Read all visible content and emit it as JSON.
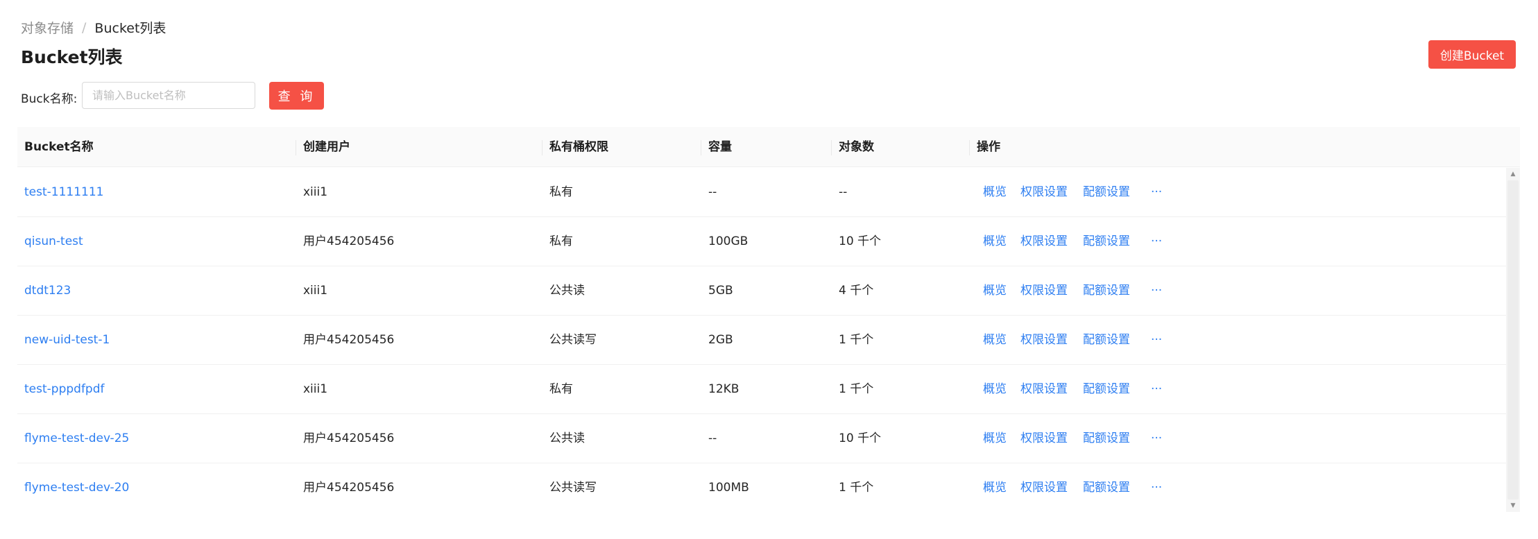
{
  "breadcrumb": {
    "root": "对象存储",
    "separator": "/",
    "current": "Bucket列表"
  },
  "page": {
    "title": "Bucket列表",
    "create_button": "创建Bucket"
  },
  "filter": {
    "label": "Buck名称:",
    "placeholder": "请输入Bucket名称",
    "value": "",
    "query_button": "查 询"
  },
  "table": {
    "columns": [
      "Bucket名称",
      "创建用户",
      "私有桶权限",
      "容量",
      "对象数",
      "操作"
    ],
    "rows": [
      {
        "name": "test-1111111",
        "user": "xiii1",
        "permission": "私有",
        "capacity": "--",
        "objects": "--"
      },
      {
        "name": "qisun-test",
        "user": "用户454205456",
        "permission": "私有",
        "capacity": "100GB",
        "objects": "10 千个"
      },
      {
        "name": "dtdt123",
        "user": "xiii1",
        "permission": "公共读",
        "capacity": "5GB",
        "objects": "4 千个"
      },
      {
        "name": "new-uid-test-1",
        "user": "用户454205456",
        "permission": "公共读写",
        "capacity": "2GB",
        "objects": "1 千个"
      },
      {
        "name": "test-pppdfpdf",
        "user": "xiii1",
        "permission": "私有",
        "capacity": "12KB",
        "objects": "1 千个"
      },
      {
        "name": "flyme-test-dev-25",
        "user": "用户454205456",
        "permission": "公共读",
        "capacity": "--",
        "objects": "10 千个"
      },
      {
        "name": "flyme-test-dev-20",
        "user": "用户454205456",
        "permission": "公共读写",
        "capacity": "100MB",
        "objects": "1 千个"
      }
    ],
    "actions": {
      "overview": "概览",
      "permission": "权限设置",
      "quota": "配额设置",
      "more": "···"
    }
  },
  "colors": {
    "primary": "#f55145",
    "link": "#2d7ef1",
    "header_bg": "#fafafa",
    "row_border": "#f0f0f0"
  },
  "icons": {
    "scroll_up": "triangle-up-icon",
    "scroll_down": "triangle-down-icon"
  }
}
